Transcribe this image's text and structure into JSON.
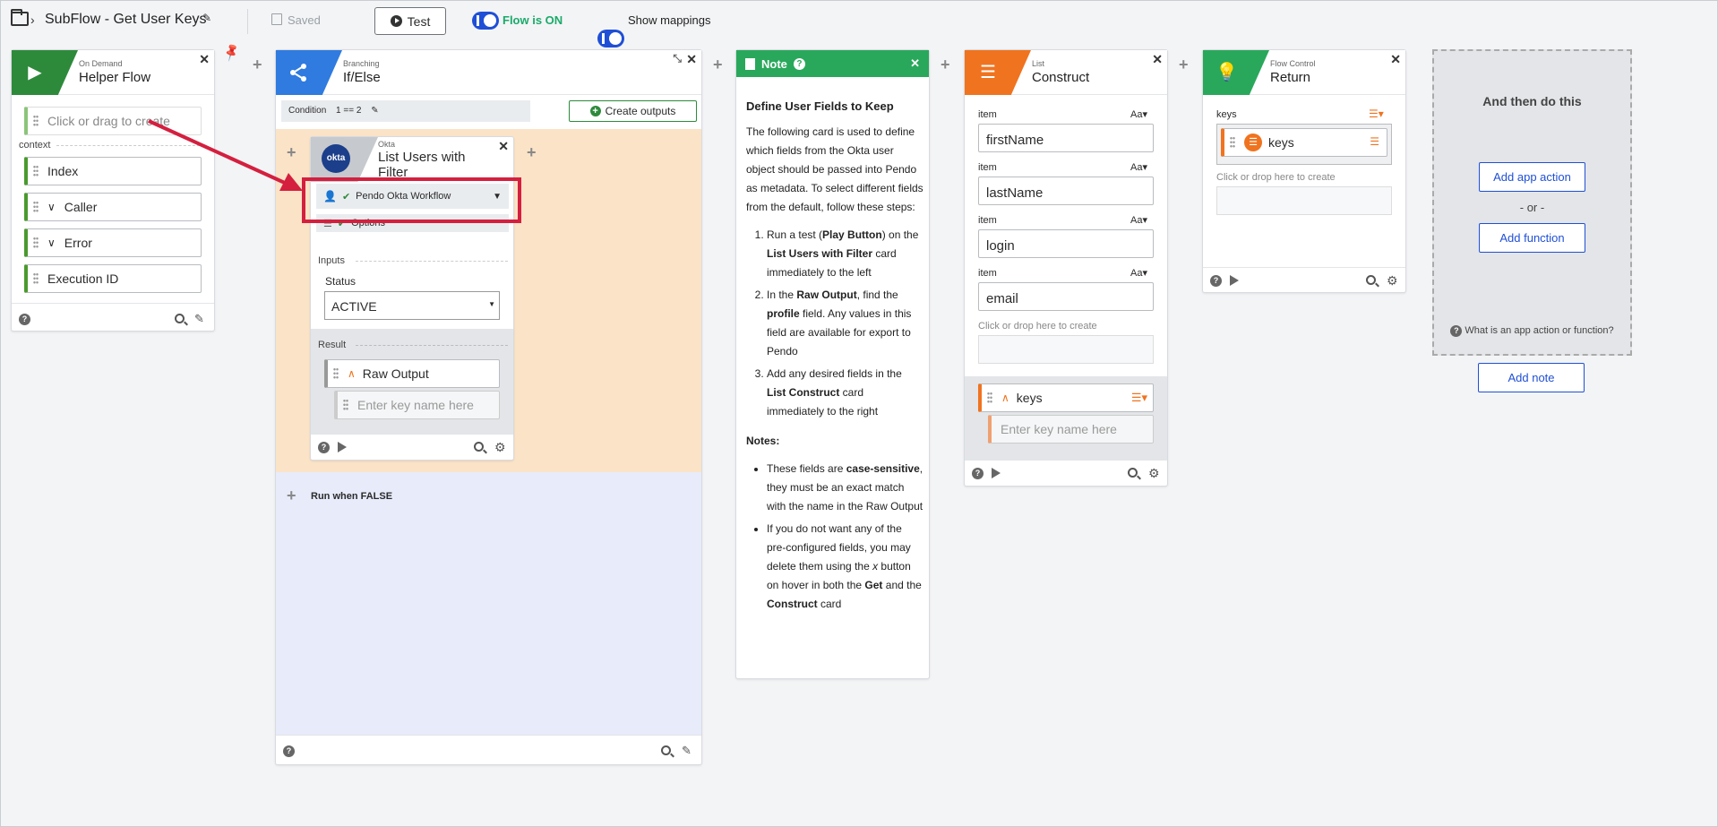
{
  "header": {
    "flow_name": "SubFlow - Get User Keys",
    "saved_label": "Saved",
    "test_label": "Test",
    "flow_status_label": "Flow is ON",
    "mappings_label": "Show mappings"
  },
  "helper_card": {
    "kind": "On Demand",
    "title": "Helper Flow",
    "placeholder": "Click or drag to create",
    "context_label": "context",
    "fields": [
      "Index",
      "Caller",
      "Error",
      "Execution ID"
    ]
  },
  "branch_card": {
    "kind": "Branching",
    "title": "If/Else",
    "condition_label": "Condition",
    "condition_value": "1 == 2",
    "create_outputs_label": "Create outputs",
    "run_false_label": "Run when FALSE"
  },
  "okta_card": {
    "logo_text": "okta",
    "kind": "Okta",
    "title": "List Users with Filter",
    "connection": "Pendo Okta Workflow",
    "options_label": "Options",
    "inputs_label": "Inputs",
    "status_label": "Status",
    "status_value": "ACTIVE",
    "result_label": "Result",
    "raw_output": "Raw Output",
    "key_placeholder": "Enter key name here"
  },
  "note_card": {
    "header_label": "Note",
    "heading": "Define User Fields to Keep",
    "intro": "The following card is used to define which fields from the Okta user object should be passed into Pendo as metadata. To select different fields from the default, follow these steps:",
    "steps": [
      {
        "pre": "Run a test (",
        "b1": "Play Button",
        "mid": ") on the ",
        "b2": "List Users with Filter",
        "post": " card immediately to the left"
      },
      {
        "pre": "In the ",
        "b1": "Raw Output",
        "mid": ", find the ",
        "b2": "profile",
        "post": " field. Any values in this field are available for export to Pendo"
      },
      {
        "pre": "Add any desired fields in the ",
        "b1": "List Construct",
        "mid": " card immediately to the right",
        "b2": "",
        "post": ""
      }
    ],
    "notes_heading": "Notes:",
    "notes": [
      {
        "pre": "These fields are ",
        "b1": "case-sensitive",
        "mid": ", they must be an exact match with the name in the Raw Output",
        "b2": "",
        "post": ""
      },
      {
        "pre": "If you do not want any of the pre-configured fields, you may delete them using the ",
        "i1": "x",
        "mid": " button on hover in both the ",
        "b1": "Get",
        "mid2": " and the ",
        "b2": "Construct",
        "post": " card"
      }
    ]
  },
  "list_card": {
    "kind": "List",
    "title": "Construct",
    "item_label": "item",
    "type_label": "Aa",
    "items": [
      "firstName",
      "lastName",
      "login",
      "email"
    ],
    "drop_hint": "Click or drop here to create",
    "output_label": "keys",
    "key_placeholder": "Enter key name here"
  },
  "return_card": {
    "kind": "Flow Control",
    "title": "Return",
    "keys_label": "keys",
    "key_chip": "keys",
    "drop_hint": "Click or drop here to create"
  },
  "next_panel": {
    "title": "And then do this",
    "add_app_action": "Add app action",
    "or_label": "- or -",
    "add_function": "Add function",
    "help_text": "What is an app action or function?",
    "add_note": "Add note"
  },
  "colors": {
    "green": "#2d8a3b",
    "blue": "#2f7be0",
    "orange": "#f0731f",
    "note_green": "#29a85b",
    "highlight_red": "#d41f3f",
    "branch_true_bg": "#fbe3c7",
    "branch_false_bg": "#e7ebfa"
  }
}
